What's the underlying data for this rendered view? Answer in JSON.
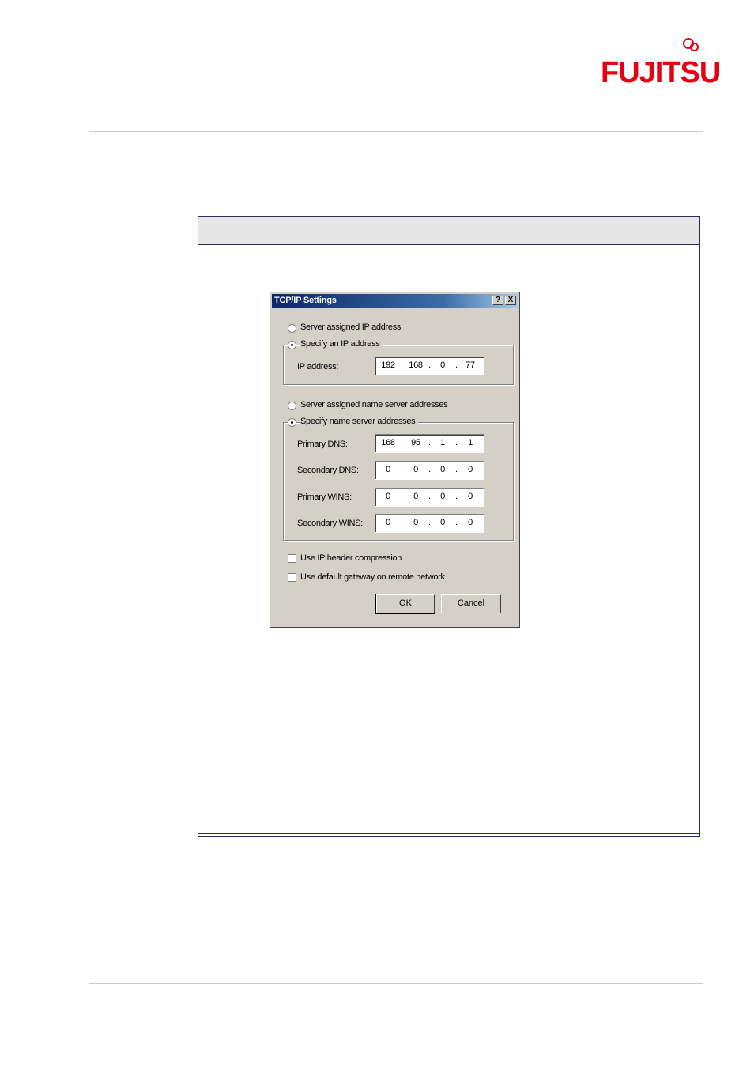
{
  "brand": {
    "logo_text": "FUJITSU",
    "color": "#e60012"
  },
  "dialog": {
    "title": "TCP/IP Settings",
    "help_button": "?",
    "close_button": "X",
    "ip": {
      "server_assigned_label": "Server assigned IP address",
      "specify_label": "Specify an IP address",
      "selected": "specify",
      "address_label": "IP address:",
      "address": [
        "192",
        "168",
        "0",
        "77"
      ]
    },
    "dns": {
      "server_assigned_label": "Server assigned name server addresses",
      "specify_label": "Specify name server addresses",
      "selected": "specify",
      "primary_dns_label": "Primary DNS:",
      "primary_dns": [
        "168",
        "95",
        "1",
        "1"
      ],
      "secondary_dns_label": "Secondary DNS:",
      "secondary_dns": [
        "0",
        "0",
        "0",
        "0"
      ],
      "primary_wins_label": "Primary WINS:",
      "primary_wins": [
        "0",
        "0",
        "0",
        "0"
      ],
      "secondary_wins_label": "Secondary WINS:",
      "secondary_wins": [
        "0",
        "0",
        "0",
        "0"
      ]
    },
    "options": {
      "header_compression_label": "Use IP header compression",
      "header_compression_checked": false,
      "default_gateway_label": "Use default gateway on remote network",
      "default_gateway_checked": false
    },
    "ok_label": "OK",
    "cancel_label": "Cancel"
  }
}
